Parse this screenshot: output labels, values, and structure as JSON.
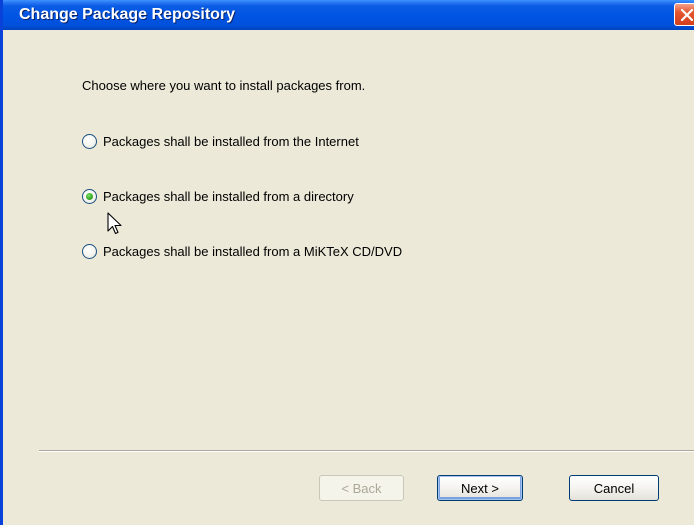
{
  "window": {
    "title": "Change Package Repository"
  },
  "prompt": "Choose where you want to install packages from.",
  "options": [
    {
      "label": "Packages shall be installed from the Internet",
      "checked": false
    },
    {
      "label": "Packages shall be installed from a directory",
      "checked": true
    },
    {
      "label": "Packages shall be installed from a MiKTeX CD/DVD",
      "checked": false
    }
  ],
  "buttons": {
    "back": {
      "label": "< Back",
      "enabled": false
    },
    "next": {
      "label": "Next >",
      "enabled": true
    },
    "cancel": {
      "label": "Cancel",
      "enabled": true
    }
  },
  "icons": {
    "close": "close-icon",
    "cursor": "mouse-pointer-icon"
  },
  "colors": {
    "titlebar": "#0054E3",
    "close": "#E3552F",
    "radio_checked": "#3FAE2C",
    "dialog_bg": "#ECE9D8"
  }
}
